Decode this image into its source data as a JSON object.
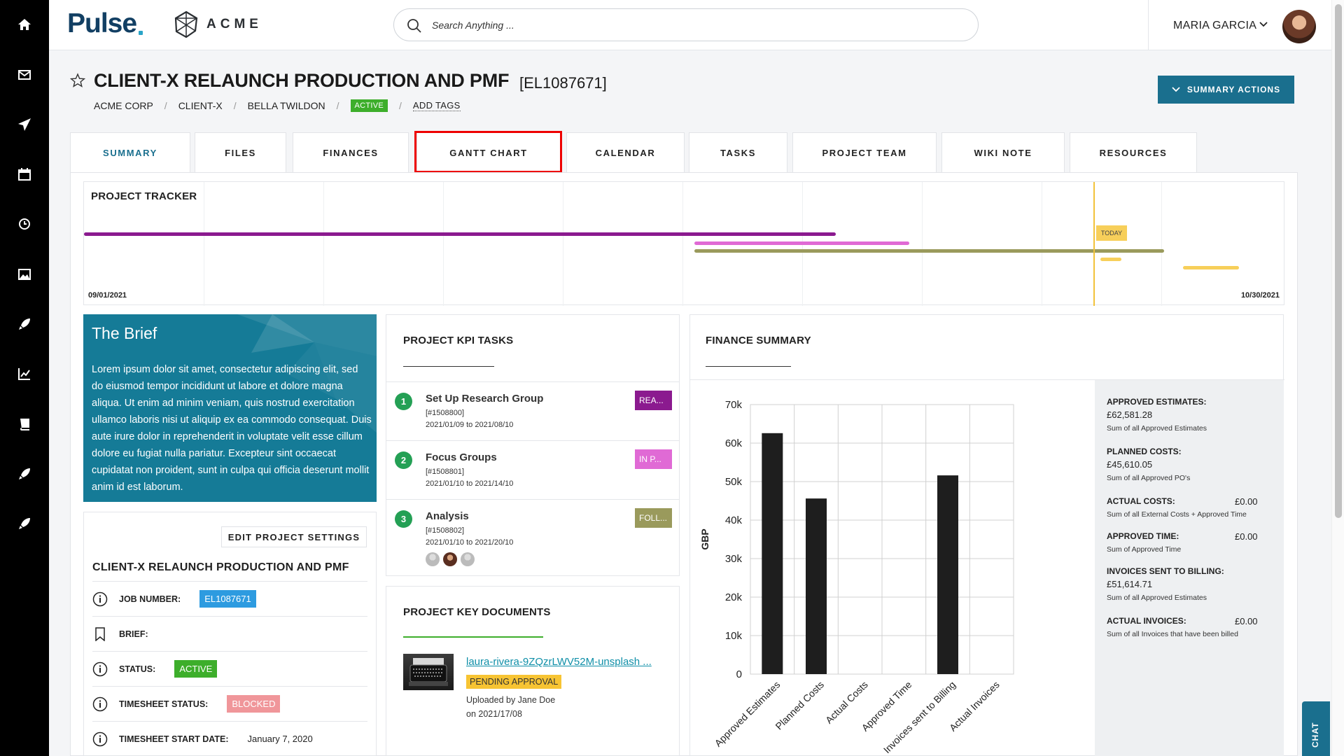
{
  "app": {
    "brand": "Pulse",
    "company_logo": "ACME"
  },
  "sidebar": {
    "items": [
      "home-icon",
      "mail-icon",
      "send-icon",
      "calendar-icon",
      "clock-icon",
      "image-icon",
      "rocket-icon",
      "trend-chart-icon",
      "book-icon",
      "rocket-icon",
      "rocket-icon"
    ]
  },
  "search": {
    "placeholder": "Search Anything ..."
  },
  "user": {
    "name": "MARIA GARCIA"
  },
  "project": {
    "title": "CLIENT-X RELAUNCH PRODUCTION AND PMF",
    "code": "[EL1087671]",
    "breadcrumb": [
      "ACME CORP",
      "CLIENT-X",
      "BELLA TWILDON"
    ],
    "status": "ACTIVE",
    "add_tags": "ADD TAGS",
    "summary_actions": "SUMMARY ACTIONS"
  },
  "tabs": [
    {
      "label": "SUMMARY",
      "active": true
    },
    {
      "label": "FILES"
    },
    {
      "label": "FINANCES"
    },
    {
      "label": "GANTT CHART",
      "highlighted": true
    },
    {
      "label": "CALENDAR"
    },
    {
      "label": "TASKS"
    },
    {
      "label": "PROJECT TEAM"
    },
    {
      "label": "WIKI NOTE"
    },
    {
      "label": "RESOURCES"
    }
  ],
  "tracker": {
    "title": "PROJECT TRACKER",
    "start_date": "09/01/2021",
    "end_date": "10/30/2021",
    "today_label": "TODAY",
    "colors": [
      "#8b1a8f",
      "#e06ad5",
      "#9a9a5c",
      "#f7cf5a"
    ]
  },
  "brief": {
    "title": "The Brief",
    "text": "Lorem ipsum dolor sit amet, consectetur adipiscing elit, sed do eiusmod tempor incididunt ut labore et dolore magna aliqua. Ut enim ad minim veniam, quis nostrud exercitation ullamco laboris nisi ut aliquip ex ea commodo consequat. Duis aute irure dolor in reprehenderit in voluptate velit esse cillum dolore eu fugiat nulla pariatur. Excepteur sint occaecat cupidatat non proident, sunt in culpa qui officia deserunt mollit anim id est laborum."
  },
  "settings": {
    "edit_button": "EDIT PROJECT SETTINGS",
    "title": "CLIENT-X RELAUNCH PRODUCTION AND PMF",
    "rows": [
      {
        "label": "JOB NUMBER:",
        "value": "EL1087671",
        "color": "#2d9be0"
      },
      {
        "label": "BRIEF:",
        "value": ""
      },
      {
        "label": "STATUS:",
        "value": "ACTIVE",
        "color": "#3dae2b"
      },
      {
        "label": "TIMESHEET STATUS:",
        "value": "BLOCKED",
        "color": "#f0969a"
      },
      {
        "label": "TIMESHEET START DATE:",
        "value": "January 7, 2020"
      }
    ]
  },
  "kpi": {
    "title": "PROJECT KPI TASKS",
    "items": [
      {
        "num": "1",
        "name": "Set Up Research Group",
        "id": "[#1508800]",
        "dates": "2021/01/09 to 2021/08/10",
        "status": "REA...",
        "color": "#8b1a8f"
      },
      {
        "num": "2",
        "name": "Focus Groups",
        "id": "[#1508801]",
        "dates": "2021/01/10 to 2021/14/10",
        "status": "IN P...",
        "color": "#e06ad5"
      },
      {
        "num": "3",
        "name": "Analysis",
        "id": "[#1508802]",
        "dates": "2021/01/10 to 2021/20/10",
        "status": "FOLL...",
        "color": "#9a9a5c"
      }
    ]
  },
  "docs": {
    "title": "PROJECT KEY DOCUMENTS",
    "file": "laura-rivera-9ZQzrLWV52M-unsplash ...",
    "status": "PENDING APPROVAL",
    "uploaded_by": "Uploaded by Jane Doe",
    "uploaded_on": "on 2021/17/08"
  },
  "finance": {
    "title": "FINANCE SUMMARY",
    "summary": [
      {
        "label": "APPROVED ESTIMATES:",
        "value": "£62,581.28",
        "desc": "Sum of all Approved Estimates"
      },
      {
        "label": "PLANNED COSTS:",
        "value": "£45,610.05",
        "desc": "Sum of all Approved PO's"
      },
      {
        "label": "ACTUAL COSTS:",
        "value": "£0.00",
        "desc": "Sum of all External Costs + Approved Time"
      },
      {
        "label": "APPROVED TIME:",
        "value": "£0.00",
        "desc": "Sum of Approved Time"
      },
      {
        "label": "INVOICES SENT TO BILLING:",
        "value": "£51,614.71",
        "desc": "Sum of all Approved Estimates"
      },
      {
        "label": "ACTUAL INVOICES:",
        "value": "£0.00",
        "desc": "Sum of all Invoices that have been billed"
      }
    ]
  },
  "chart_data": {
    "type": "bar",
    "categories": [
      "Approved Estimates",
      "Planned Costs",
      "Actual Costs",
      "Approved Time",
      "Invoices sent to Billing",
      "Actual Invoices"
    ],
    "values": [
      62581.28,
      45610.05,
      0,
      0,
      51614.71,
      0
    ],
    "ylabel": "GBP",
    "yticks": [
      "0",
      "10k",
      "20k",
      "30k",
      "40k",
      "50k",
      "60k",
      "70k"
    ],
    "ylim": [
      0,
      70000
    ],
    "bar_color": "#1e1e1e",
    "grid": true
  },
  "chat": {
    "label": "CHAT"
  }
}
